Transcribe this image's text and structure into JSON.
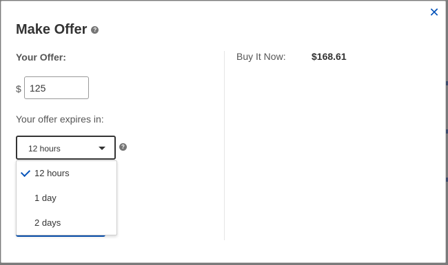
{
  "dialog": {
    "title": "Make Offer",
    "help_glyph": "?",
    "close_glyph": "✕"
  },
  "offer": {
    "label": "Your Offer:",
    "currency_symbol": "$",
    "value": "125"
  },
  "expires": {
    "label": "Your offer expires in:",
    "selected": "12 hours",
    "options": [
      "12 hours",
      "1 day",
      "2 days"
    ]
  },
  "buy_it_now": {
    "label": "Buy It Now:",
    "price": "$168.61"
  },
  "hidden": {
    "link_fragment": "r"
  },
  "colors": {
    "accent": "#0654ba",
    "text": "#333333",
    "muted": "#555555"
  }
}
